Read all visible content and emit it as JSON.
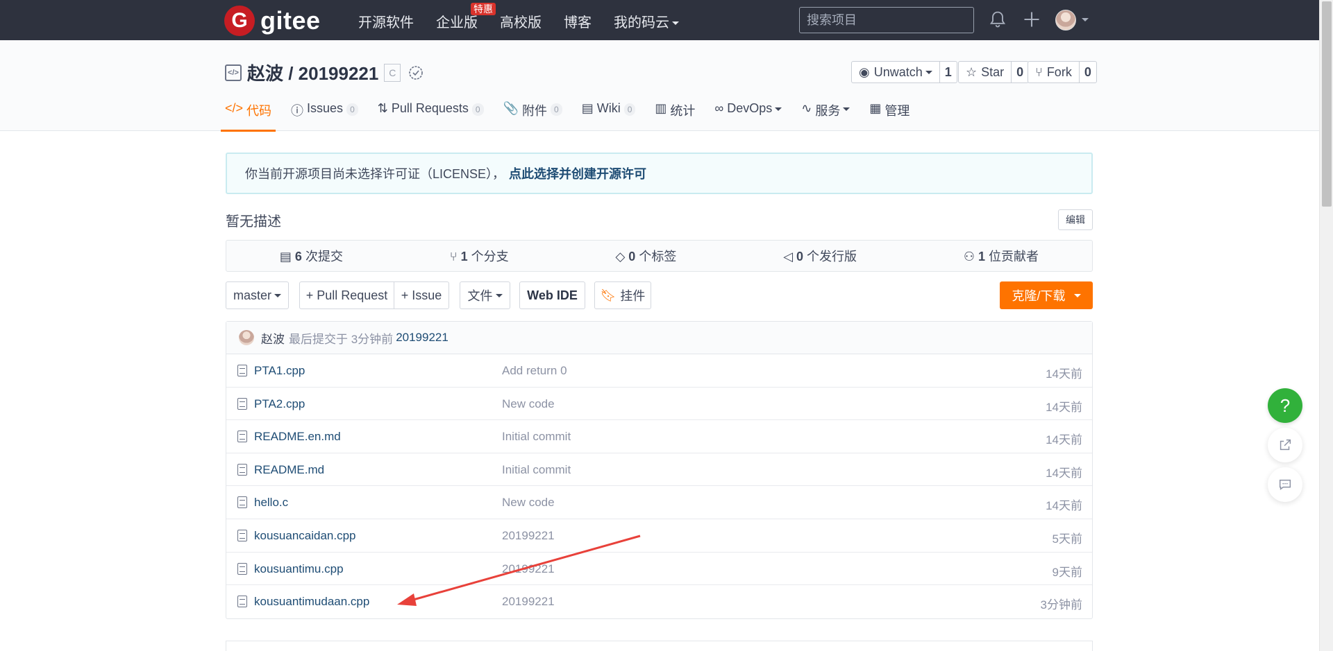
{
  "topnav": {
    "logo_text": "gitee",
    "logo_mark": "G",
    "links": [
      {
        "label": "开源软件"
      },
      {
        "label": "企业版",
        "badge": "特惠"
      },
      {
        "label": "高校版"
      },
      {
        "label": "博客"
      },
      {
        "label": "我的码云",
        "dropdown": true
      }
    ],
    "search_placeholder": "搜索项目",
    "icons": [
      "bell-icon",
      "plus-icon"
    ]
  },
  "repo": {
    "title": "赵波 / 20199221",
    "lang_badge": "C",
    "actions": [
      {
        "label": "Unwatch",
        "count": "1",
        "icon": "eye-icon"
      },
      {
        "label": "Star",
        "count": "0",
        "icon": "star-icon"
      },
      {
        "label": "Fork",
        "count": "0",
        "icon": "fork-icon"
      }
    ],
    "tabs": [
      {
        "label": "代码",
        "icon": "</>",
        "active": true
      },
      {
        "label": "Issues",
        "badge": "0",
        "icon": "ⓘ"
      },
      {
        "label": "Pull Requests",
        "badge": "0",
        "icon": "⇅"
      },
      {
        "label": "附件",
        "badge": "0",
        "icon": "📎"
      },
      {
        "label": "Wiki",
        "badge": "0",
        "icon": "▤"
      },
      {
        "label": "统计",
        "icon": "▥"
      },
      {
        "label": "DevOps",
        "icon": "∞",
        "dropdown": true
      },
      {
        "label": "服务",
        "icon": "∿",
        "dropdown": true
      },
      {
        "label": "管理",
        "icon": "▦"
      }
    ]
  },
  "notice": {
    "text": "你当前开源项目尚未选择许可证（LICENSE），",
    "link": "点此选择并创建开源许可"
  },
  "description": "暂无描述",
  "edit_label": "编辑",
  "stats": [
    {
      "num": "6",
      "label": "次提交",
      "icon": "commit-icon"
    },
    {
      "num": "1",
      "label": "个分支",
      "icon": "branch-icon"
    },
    {
      "num": "0",
      "label": "个标签",
      "icon": "tag-icon"
    },
    {
      "num": "0",
      "label": "个发行版",
      "icon": "release-icon"
    },
    {
      "num": "1",
      "label": "位贡献者",
      "icon": "contributors-icon"
    }
  ],
  "buttons": {
    "branch": "master",
    "pull_request": "+ Pull Request",
    "issue": "+ Issue",
    "files": "文件",
    "web_ide": "Web IDE",
    "widget": "挂件",
    "clone": "克隆/下载"
  },
  "last_commit": {
    "author": "赵波",
    "text": "最后提交于 3分钟前",
    "id": "20199221"
  },
  "files": [
    {
      "name": "PTA1.cpp",
      "message": "Add return 0",
      "time": "14天前"
    },
    {
      "name": "PTA2.cpp",
      "message": "New code",
      "time": "14天前"
    },
    {
      "name": "README.en.md",
      "message": "Initial commit",
      "time": "14天前"
    },
    {
      "name": "README.md",
      "message": "Initial commit",
      "time": "14天前"
    },
    {
      "name": "hello.c",
      "message": "New code",
      "time": "14天前"
    },
    {
      "name": "kousuancaidan.cpp",
      "message": "20199221",
      "time": "5天前"
    },
    {
      "name": "kousuantimu.cpp",
      "message": "20199221",
      "time": "9天前"
    },
    {
      "name": "kousuantimudaan.cpp",
      "message": "20199221",
      "time": "3分钟前"
    }
  ],
  "floating": {
    "help": "?"
  },
  "colors": {
    "accent": "#fe7300",
    "nav_bg": "#2e323e",
    "link": "#1e4c74",
    "annotation_arrow": "#e8413a"
  }
}
